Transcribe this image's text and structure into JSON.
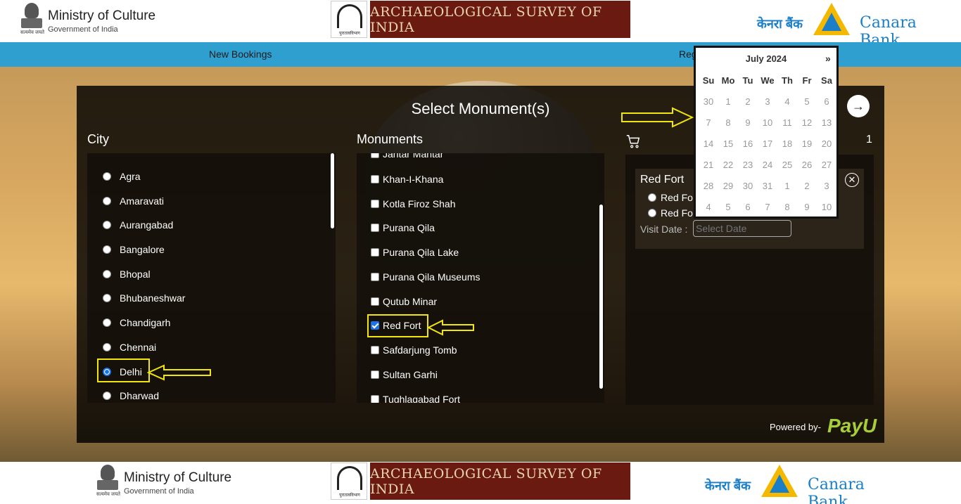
{
  "header": {
    "ministry_title": "Ministry of Culture",
    "ministry_sub": "Government of India",
    "emblem_motto": "सत्यमेव जयते",
    "asi_title": "ARCHAEOLOGICAL SURVEY OF INDIA",
    "asi_logo_text": "पुरातत्वविभाग",
    "bank_hindi": "केनरा बैंक",
    "bank_name": "Canara Bank"
  },
  "nav": {
    "new_bookings": "New Bookings",
    "reg": "Reg"
  },
  "panel": {
    "title": "Select Monument(s)",
    "city_label": "City",
    "monuments_label": "Monuments"
  },
  "cities": [
    {
      "label": "Agra",
      "checked": false
    },
    {
      "label": "Amaravati",
      "checked": false
    },
    {
      "label": "Aurangabad",
      "checked": false
    },
    {
      "label": "Bangalore",
      "checked": false
    },
    {
      "label": "Bhopal",
      "checked": false
    },
    {
      "label": "Bhubaneshwar",
      "checked": false
    },
    {
      "label": "Chandigarh",
      "checked": false
    },
    {
      "label": "Chennai",
      "checked": false
    },
    {
      "label": "Delhi",
      "checked": true
    },
    {
      "label": "Dharwad",
      "checked": false
    }
  ],
  "monuments": [
    {
      "label": "Jantar Mantar",
      "checked": false
    },
    {
      "label": "Khan-I-Khana",
      "checked": false
    },
    {
      "label": "Kotla Firoz Shah",
      "checked": false
    },
    {
      "label": "Purana Qila",
      "checked": false
    },
    {
      "label": "Purana Qila Lake",
      "checked": false
    },
    {
      "label": "Purana Qila Museums",
      "checked": false
    },
    {
      "label": "Qutub Minar",
      "checked": false
    },
    {
      "label": "Red Fort",
      "checked": true
    },
    {
      "label": "Safdarjung Tomb",
      "checked": false
    },
    {
      "label": "Sultan Garhi",
      "checked": false
    },
    {
      "label": "Tughlaqabad Fort",
      "checked": false
    }
  ],
  "cart": {
    "count": "1",
    "item_name": "Red Fort",
    "options": [
      "Red Fo",
      "Red Fo"
    ],
    "visit_label": "Visit Date :",
    "date_placeholder": "Select Date"
  },
  "calendar": {
    "month": "July 2024",
    "next": "»",
    "days_of_week": [
      "Su",
      "Mo",
      "Tu",
      "We",
      "Th",
      "Fr",
      "Sa"
    ],
    "weeks": [
      [
        "30",
        "1",
        "2",
        "3",
        "4",
        "5",
        "6"
      ],
      [
        "7",
        "8",
        "9",
        "10",
        "11",
        "12",
        "13"
      ],
      [
        "14",
        "15",
        "16",
        "17",
        "18",
        "19",
        "20"
      ],
      [
        "21",
        "22",
        "23",
        "24",
        "25",
        "26",
        "27"
      ],
      [
        "28",
        "29",
        "30",
        "31",
        "1",
        "2",
        "3"
      ],
      [
        "4",
        "5",
        "6",
        "7",
        "8",
        "9",
        "10"
      ]
    ]
  },
  "footer": {
    "powered_by": "Powered by-",
    "payu": "PayU"
  },
  "colors": {
    "nav_bg": "#2f9fd0",
    "asi_band": "#6b1a12",
    "highlight": "#f1e60a",
    "bank_blue": "#1a7fc6",
    "payu_green": "#a6ce39"
  }
}
